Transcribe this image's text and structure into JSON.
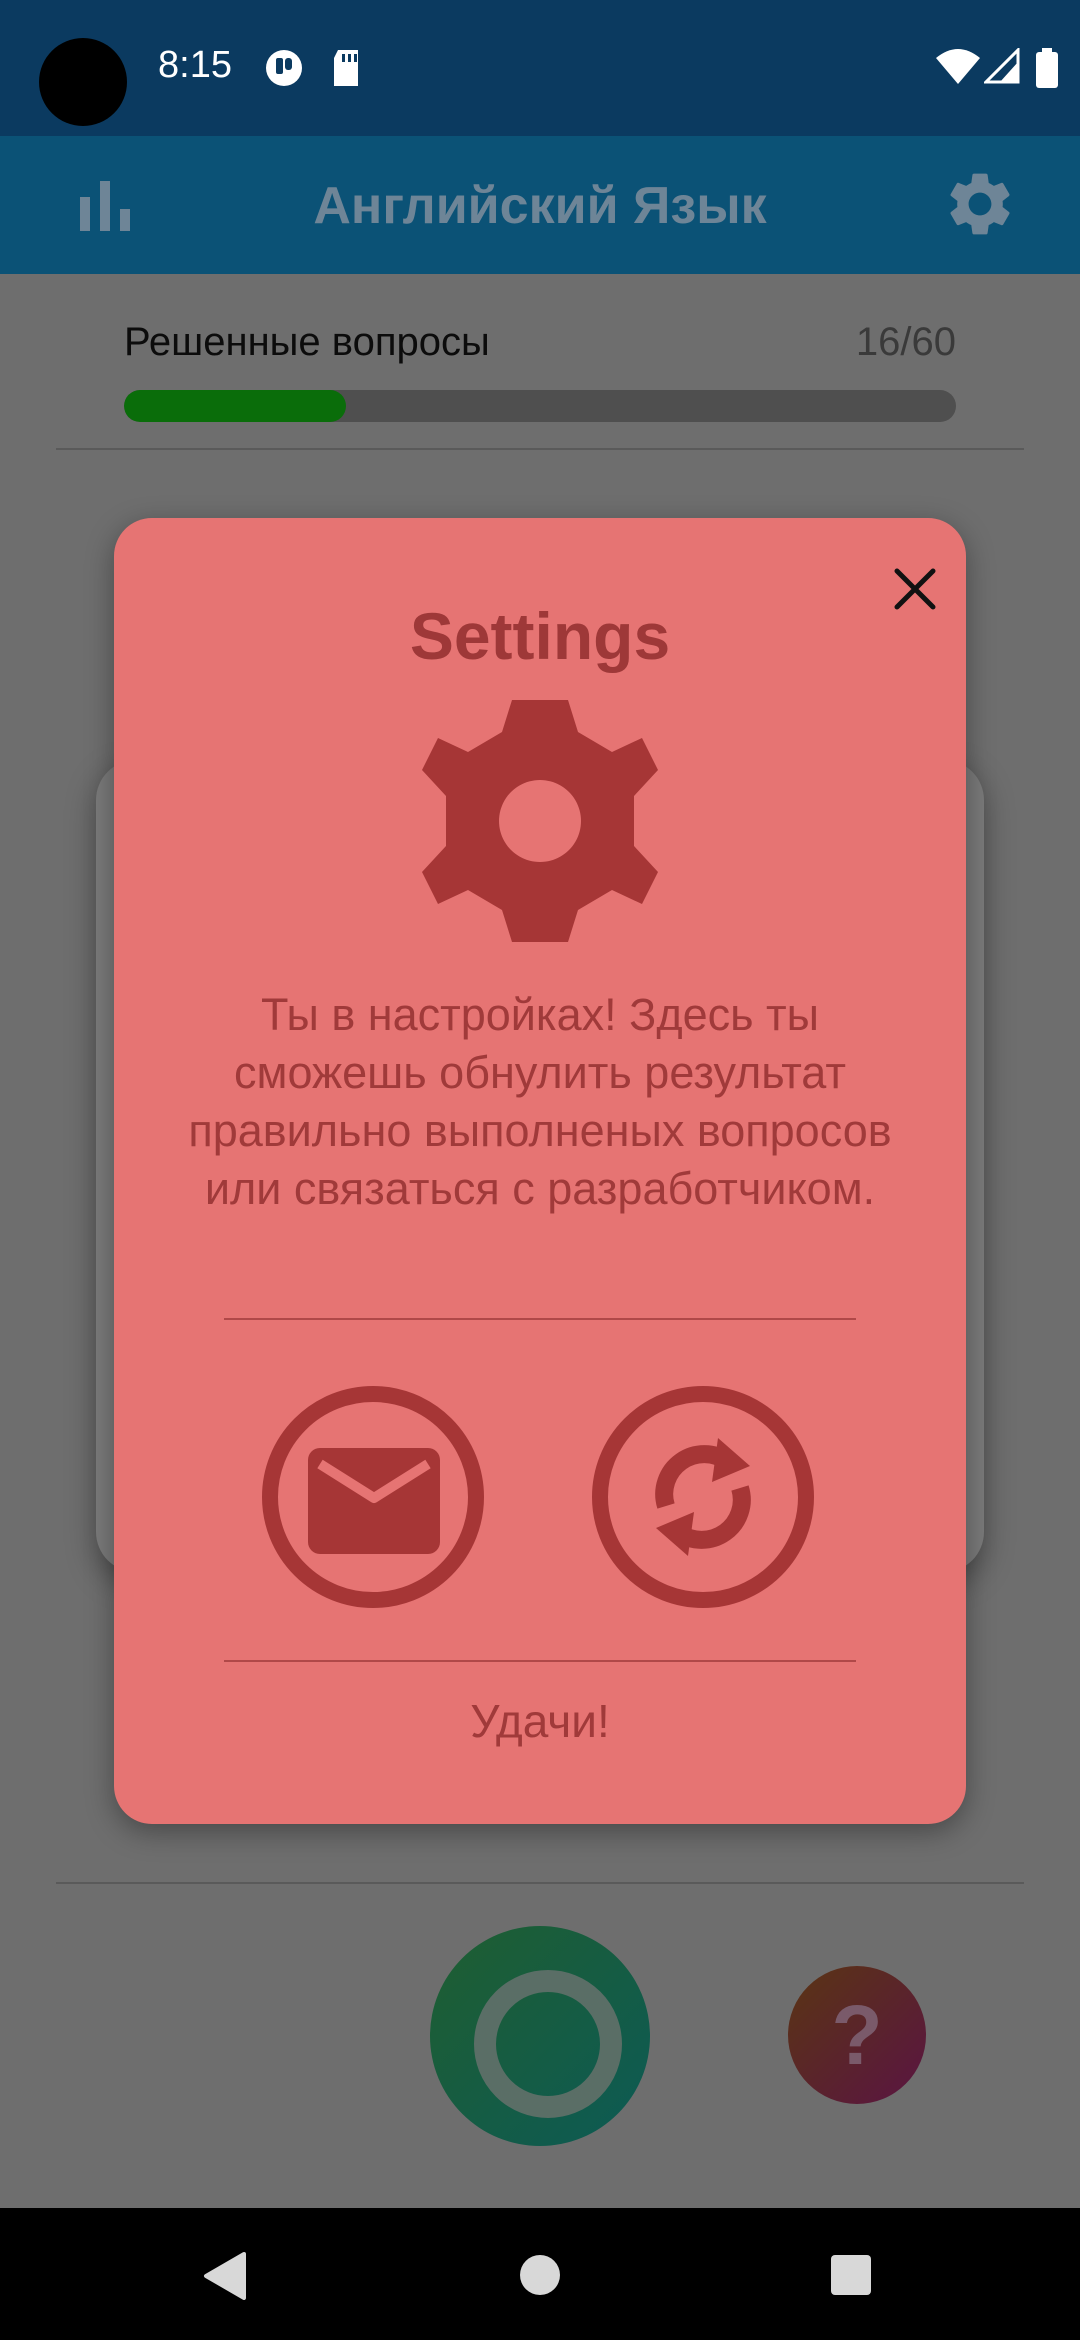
{
  "status_bar": {
    "time": "8:15"
  },
  "app_bar": {
    "title": "Английский Язык"
  },
  "progress": {
    "label": "Решенные вопросы",
    "count": "16/60",
    "fraction": 0.2667
  },
  "dialog": {
    "title": "Settings",
    "message": "Ты в настройках! Здесь ты сможешь обнулить результат правильно выполненых вопросов или связаться с разработчиком.",
    "footer": "Удачи!"
  },
  "help_button": {
    "label": "?"
  },
  "icons": {
    "stats": "bar-chart-icon",
    "settings": "gear-icon",
    "close": "close-icon",
    "mail": "mail-icon",
    "reset": "refresh-icon",
    "record": "radio-ring-icon",
    "help": "question-icon"
  },
  "colors": {
    "status_bar": "#0b3a60",
    "app_bar": "#0b5276",
    "dialog_bg": "#e67473",
    "dialog_accent": "#a63636",
    "progress_fill": "#0a6d0a"
  }
}
